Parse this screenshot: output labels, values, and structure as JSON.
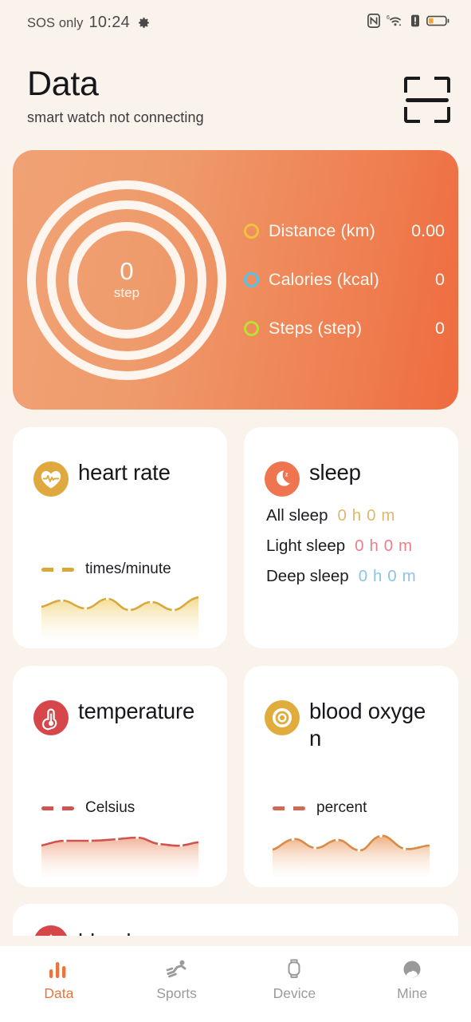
{
  "status_bar": {
    "carrier": "SOS only",
    "time": "10:24",
    "gear_icon": "gear-icon",
    "nfc_icon": "nfc-icon",
    "wifi_icon": "wifi-6-icon",
    "alert_icon": "battery-alert-icon",
    "battery_icon": "battery-low-icon"
  },
  "header": {
    "title": "Data",
    "subtitle": "smart watch not connecting",
    "scan_icon": "scan-icon"
  },
  "activity": {
    "steps_value": "0",
    "steps_unit": "step",
    "legend": [
      {
        "label": "Distance (km)",
        "value": "0.00",
        "color": "#f2c23e"
      },
      {
        "label": "Calories (kcal)",
        "value": "0",
        "color": "#56c2e8"
      },
      {
        "label": "Steps (step)",
        "value": "0",
        "color": "#bede34"
      }
    ]
  },
  "cards": {
    "heart_rate": {
      "title": "heart rate",
      "icon": "heart-rate-icon",
      "icon_color": "#e0a93f",
      "unit": "times/minute",
      "line_color": "#d8a83c"
    },
    "sleep": {
      "title": "sleep",
      "icon": "sleep-moon-icon",
      "icon_color": "#ef7450",
      "rows": [
        {
          "label": "All sleep",
          "value": "0 h 0 m",
          "color": "#dcb96e"
        },
        {
          "label": "Light sleep",
          "value": "0 h 0 m",
          "color": "#e8808a"
        },
        {
          "label": "Deep sleep",
          "value": "0 h 0 m",
          "color": "#8cc4e6"
        }
      ]
    },
    "temperature": {
      "title": "temperature",
      "icon": "thermometer-icon",
      "icon_color": "#d6474b",
      "unit": "Celsius",
      "line_color": "#cf5450"
    },
    "blood_oxygen": {
      "title": "blood oxygen",
      "icon": "bullseye-icon",
      "icon_color": "#e0ad3c",
      "unit": "percent",
      "line_color": "#d88c48"
    },
    "blood_partial": {
      "title": "blood",
      "icon": "blood-drop-icon",
      "icon_color": "#d6474b"
    }
  },
  "chart_data": [
    {
      "type": "area",
      "title": "heart rate",
      "ylabel": "times/minute",
      "x": [
        0,
        1,
        2,
        3,
        4,
        5,
        6,
        7,
        8,
        9,
        10,
        11
      ],
      "values": [
        44,
        52,
        56,
        50,
        46,
        58,
        52,
        44,
        56,
        48,
        46,
        60
      ],
      "line_color": "#d8a83c",
      "grid": false,
      "legend": "times/minute"
    },
    {
      "type": "area",
      "title": "temperature",
      "ylabel": "Celsius",
      "x": [
        0,
        1,
        2,
        3,
        4,
        5,
        6,
        7,
        8,
        9,
        10,
        11
      ],
      "values": [
        48,
        54,
        56,
        55,
        56,
        60,
        58,
        50,
        48,
        46,
        50,
        54
      ],
      "line_color": "#cf5450",
      "grid": false,
      "legend": "Celsius"
    },
    {
      "type": "area",
      "title": "blood oxygen",
      "ylabel": "percent",
      "x": [
        0,
        1,
        2,
        3,
        4,
        5,
        6,
        7,
        8,
        9,
        10,
        11
      ],
      "values": [
        40,
        56,
        68,
        52,
        44,
        64,
        54,
        42,
        70,
        76,
        54,
        46
      ],
      "line_color": "#d88c48",
      "grid": false,
      "legend": "percent"
    }
  ],
  "tabbar": {
    "items": [
      {
        "label": "Data",
        "icon": "bar-chart-icon",
        "active": true
      },
      {
        "label": "Sports",
        "icon": "runner-icon",
        "active": false
      },
      {
        "label": "Device",
        "icon": "watch-icon",
        "active": false
      },
      {
        "label": "Mine",
        "icon": "person-icon",
        "active": false
      }
    ]
  }
}
